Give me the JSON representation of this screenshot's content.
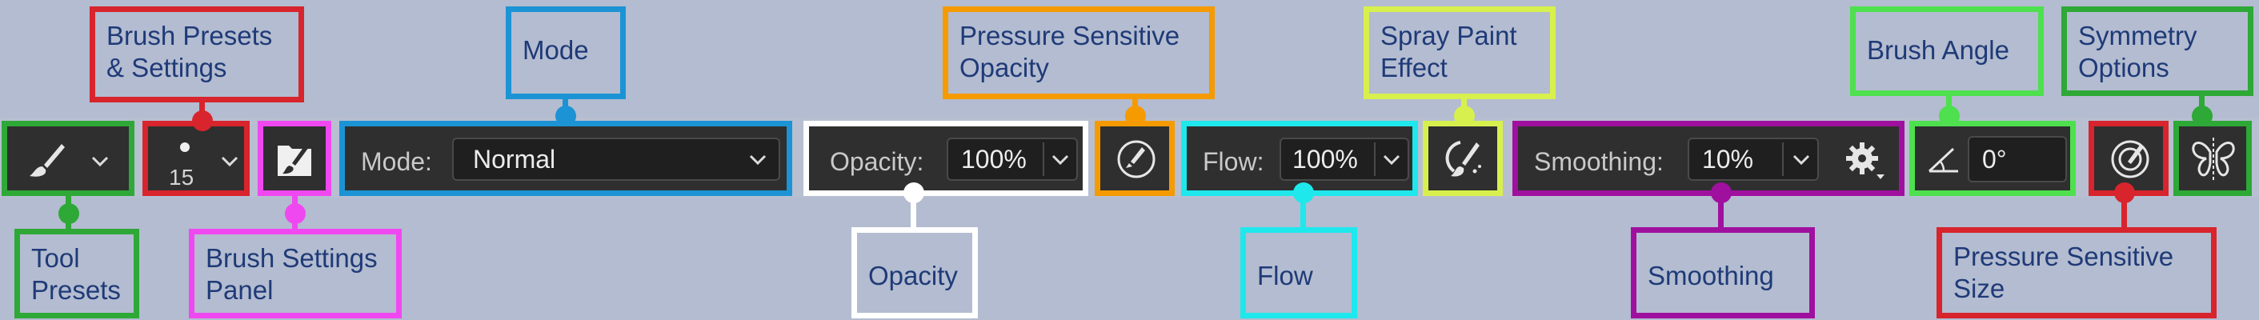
{
  "toolbar": {
    "brush_size": "15",
    "mode_label": "Mode:",
    "mode_value": "Normal",
    "opacity_label": "Opacity:",
    "opacity_value": "100%",
    "flow_label": "Flow:",
    "flow_value": "100%",
    "smoothing_label": "Smoothing:",
    "smoothing_value": "10%",
    "angle_value": "0°"
  },
  "callouts": {
    "tool_presets": "Tool\nPresets",
    "brush_presets": "Brush Presets\n& Settings",
    "brush_settings_panel": "Brush Settings\nPanel",
    "mode": "Mode",
    "opacity": "Opacity",
    "pressure_opacity": "Pressure Sensitive\nOpacity",
    "flow": "Flow",
    "spray_paint": "Spray Paint\nEffect",
    "smoothing": "Smoothing",
    "brush_angle": "Brush Angle",
    "pressure_size": "Pressure Sensitive\nSize",
    "symmetry": "Symmetry\nOptions"
  },
  "colors": {
    "tool_presets": "#2ea836",
    "brush_presets": "#d8242c",
    "brush_settings_panel": "#f048f0",
    "mode": "#1c93d4",
    "opacity": "#ffffff",
    "pressure_opacity": "#f59a00",
    "flow": "#1ee8ec",
    "spray_paint": "#d8f04e",
    "smoothing": "#a0109e",
    "brush_angle": "#4ee04e",
    "pressure_size": "#d8242c",
    "symmetry": "#2ea836"
  },
  "icons": [
    "brush-icon",
    "chevron-down-icon",
    "brush-tip-dot-icon",
    "brush-folder-icon",
    "pressure-opacity-icon",
    "airbrush-icon",
    "gear-icon",
    "angle-icon",
    "pressure-size-icon",
    "butterfly-symmetry-icon"
  ]
}
